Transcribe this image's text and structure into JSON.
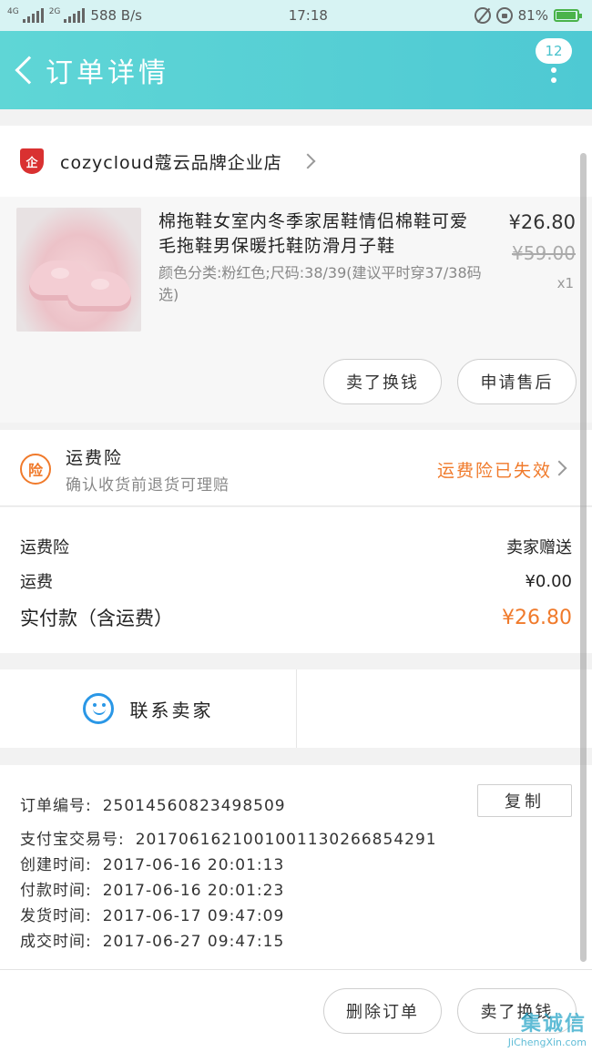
{
  "status_bar": {
    "net_tag_1": "4G",
    "net_tag_2": "2G",
    "speed": "588 B/s",
    "time": "17:18",
    "battery": "81%"
  },
  "header": {
    "title": "订单详情",
    "badge": "12"
  },
  "store": {
    "logo_text": "企",
    "name": "cozycloud蔻云品牌企业店"
  },
  "product": {
    "title": "棉拖鞋女室内冬季家居鞋情侣棉鞋可爱毛拖鞋男保暖托鞋防滑月子鞋",
    "sku": "颜色分类:粉红色;尺码:38/39(建议平时穿37/38码选)",
    "price": "¥26.80",
    "original_price": "¥59.00",
    "quantity": "x1",
    "buttons": [
      "卖了换钱",
      "申请售后"
    ]
  },
  "insurance": {
    "icon_text": "险",
    "title": "运费险",
    "subtitle": "确认收货前退货可理赔",
    "status": "运费险已失效"
  },
  "fees": {
    "rows": [
      {
        "label": "运费险",
        "value": "卖家赠送"
      },
      {
        "label": "运费",
        "value": "¥0.00"
      },
      {
        "label": "实付款（含运费）",
        "value": "¥26.80"
      }
    ],
    "total_color": "#f07a2b"
  },
  "contact": {
    "label": "联系卖家"
  },
  "order_info": {
    "copy_label": "复制",
    "lines": [
      {
        "label": "订单编号:",
        "value": "250145608234985​09"
      },
      {
        "label": "支付宝交易号:",
        "value": "2017061621001001130266854291"
      },
      {
        "label": "创建时间:",
        "value": "2017-06-16 20:01:13"
      },
      {
        "label": "付款时间:",
        "value": "2017-06-16 20:01:23"
      },
      {
        "label": "发货时间:",
        "value": "2017-06-17 09:47:09"
      },
      {
        "label": "成交时间:",
        "value": "2017-06-27 09:47:15"
      }
    ]
  },
  "bottom_bar": {
    "buttons": [
      "删除订单",
      "卖了换钱"
    ]
  },
  "watermark": {
    "logo": "集诚信",
    "text": "JiChengXin.com"
  },
  "colors": {
    "header": "#4ec9d3",
    "accent_orange": "#f07a2b",
    "chat_blue": "#2a97e6",
    "store_red": "#d93131"
  }
}
